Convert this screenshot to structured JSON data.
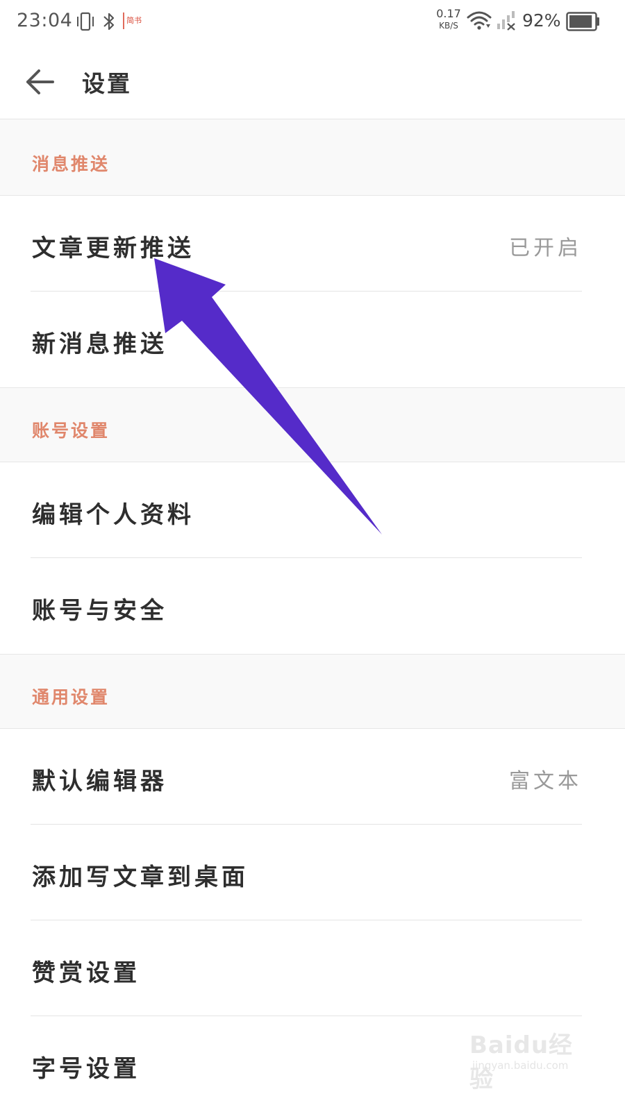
{
  "status_bar": {
    "time": "23:04",
    "app_badge": "简书",
    "net_speed_value": "0.17",
    "net_speed_unit": "KB/S",
    "battery_percent": "92%",
    "battery_level": 0.92,
    "icons": [
      "vibrate-icon",
      "bluetooth-icon",
      "wifi-icon",
      "signal-icon",
      "battery-icon"
    ]
  },
  "header": {
    "back_icon": "back-arrow-icon",
    "title": "设置"
  },
  "sections": {
    "push": {
      "title": "消息推送",
      "items": [
        {
          "label": "文章更新推送",
          "value": "已开启"
        },
        {
          "label": "新消息推送",
          "value": ""
        }
      ]
    },
    "account": {
      "title": "账号设置",
      "items": [
        {
          "label": "编辑个人资料",
          "value": ""
        },
        {
          "label": "账号与安全",
          "value": ""
        }
      ]
    },
    "general": {
      "title": "通用设置",
      "items": [
        {
          "label": "默认编辑器",
          "value": "富文本"
        },
        {
          "label": "添加写文章到桌面",
          "value": ""
        },
        {
          "label": "赞赏设置",
          "value": ""
        },
        {
          "label": "字号设置",
          "value": ""
        }
      ]
    }
  },
  "annotation": {
    "type": "arrow",
    "color": "#552bc9"
  },
  "watermark": {
    "main": "Baidu经验",
    "sub": "jingyan.baidu.com"
  },
  "colors": {
    "section_title": "#e0876c",
    "section_bg": "#f9f9f9",
    "divider": "#e4e4e4",
    "value_text": "#999999"
  }
}
